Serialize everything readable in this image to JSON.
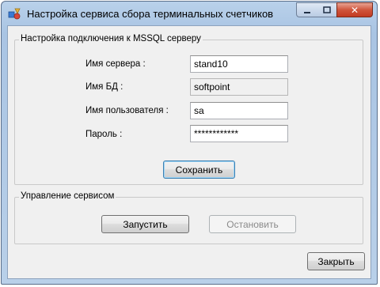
{
  "window": {
    "title": "Настройка сервиса сбора терминальных счетчиков",
    "close_glyph": "✕",
    "icon": "app-shapes-icon"
  },
  "connection_group": {
    "title": "Настройка подключения к MSSQL серверу",
    "fields": [
      {
        "label": "Имя сервера :",
        "value": "stand10"
      },
      {
        "label": "Имя БД :",
        "value": "softpoint"
      },
      {
        "label": "Имя пользователя :",
        "value": "sa"
      },
      {
        "label": "Пароль :",
        "value": "************"
      }
    ],
    "save_button": "Сохранить"
  },
  "service_group": {
    "title": "Управление сервисом",
    "start_button": "Запустить",
    "stop_button": "Остановить"
  },
  "close_button": "Закрыть",
  "colors": {
    "title_bar": "#b9d1ea",
    "client": "#f0f0f0",
    "close_caption": "#c23b22",
    "focus_border": "#3c7fb1"
  }
}
